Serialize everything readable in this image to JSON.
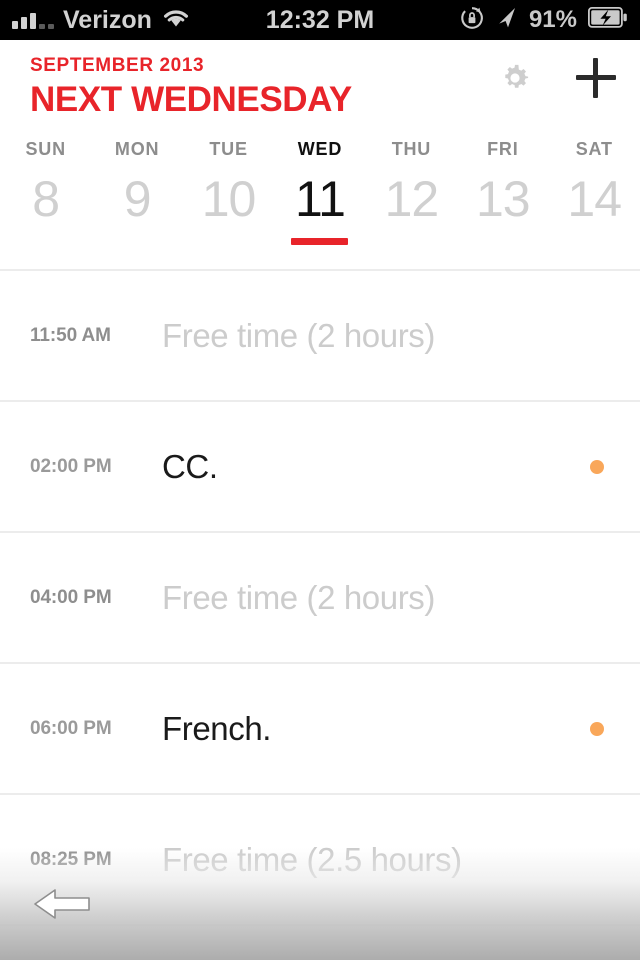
{
  "status_bar": {
    "carrier": "Verizon",
    "signal_icon": "signal-bars-icon",
    "wifi_icon": "wifi-icon",
    "time": "12:32 PM",
    "rotation_lock_icon": "rotation-lock-icon",
    "location_icon": "location-arrow-icon",
    "battery_percent": "91%",
    "battery_icon": "battery-charging-icon"
  },
  "header": {
    "month": "SEPTEMBER 2013",
    "title": "NEXT WEDNESDAY",
    "settings_icon": "gear-icon",
    "add_icon": "plus-icon",
    "accent_color": "#e8242a"
  },
  "week": {
    "days": [
      {
        "dow": "SUN",
        "date": "8",
        "active": false
      },
      {
        "dow": "MON",
        "date": "9",
        "active": false
      },
      {
        "dow": "TUE",
        "date": "10",
        "active": false
      },
      {
        "dow": "WED",
        "date": "11",
        "active": true
      },
      {
        "dow": "THU",
        "date": "12",
        "active": false
      },
      {
        "dow": "FRI",
        "date": "13",
        "active": false
      },
      {
        "dow": "SAT",
        "date": "14",
        "active": false
      }
    ]
  },
  "agenda": {
    "rows": [
      {
        "time": "11:50 AM",
        "title": "Free time (2 hours)",
        "type": "free",
        "dot": false
      },
      {
        "time": "02:00 PM",
        "title": "CC.",
        "type": "event",
        "dot": true
      },
      {
        "time": "04:00 PM",
        "title": "Free time (2 hours)",
        "type": "free",
        "dot": false
      },
      {
        "time": "06:00 PM",
        "title": "French.",
        "type": "event",
        "dot": true
      },
      {
        "time": "08:25 PM",
        "title": "Free time (2.5 hours)",
        "type": "free",
        "dot": false
      }
    ],
    "dot_color": "#f9a75a"
  },
  "cursor": {
    "icon": "mouse-arrow-left-icon"
  }
}
